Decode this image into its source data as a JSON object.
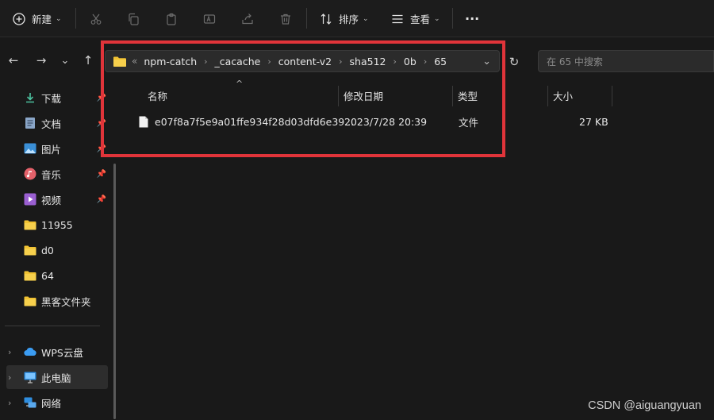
{
  "toolbar": {
    "new_label": "新建",
    "sort_label": "排序",
    "view_label": "查看",
    "more_label": "···",
    "icons": [
      "plus-circle-icon",
      "cut-icon",
      "copy-icon",
      "paste-icon",
      "rename-icon",
      "share-icon",
      "delete-icon",
      "sort-icon",
      "view-icon",
      "more-icon"
    ]
  },
  "nav": {
    "back_icon": "←",
    "forward_icon": "→",
    "recent_icon": "⌄",
    "up_icon": "↑",
    "overflow": "«",
    "breadcrumbs": [
      "npm-catch",
      "_cacache",
      "content-v2",
      "sha512",
      "0b",
      "65"
    ],
    "dropdown_icon": "⌄",
    "refresh_icon": "↻",
    "search_placeholder": "在 65 中搜索"
  },
  "sidebar": {
    "quick_access": [
      {
        "label": "下载",
        "icon": "download-icon",
        "pinned": true
      },
      {
        "label": "文档",
        "icon": "document-icon",
        "pinned": true
      },
      {
        "label": "图片",
        "icon": "picture-icon",
        "pinned": true
      },
      {
        "label": "音乐",
        "icon": "music-icon",
        "pinned": true
      },
      {
        "label": "视频",
        "icon": "video-icon",
        "pinned": true
      },
      {
        "label": "11955",
        "icon": "folder-icon",
        "pinned": false
      },
      {
        "label": "d0",
        "icon": "folder-icon",
        "pinned": false
      },
      {
        "label": "64",
        "icon": "folder-icon",
        "pinned": false
      },
      {
        "label": "黑客文件夹",
        "icon": "folder-icon",
        "pinned": false
      }
    ],
    "locations": [
      {
        "label": "WPS云盘",
        "icon": "cloud-icon"
      },
      {
        "label": "此电脑",
        "icon": "computer-icon",
        "selected": true
      },
      {
        "label": "网络",
        "icon": "network-icon"
      }
    ]
  },
  "columns": {
    "name": "名称",
    "date": "修改日期",
    "type": "类型",
    "size": "大小"
  },
  "files": [
    {
      "name": "e07f8a7f5e9a01ffe934f28d03dfd6e39...",
      "date": "2023/7/28 20:39",
      "type": "文件",
      "size": "27 KB"
    }
  ],
  "watermark": "CSDN @aiguangyuan",
  "colors": {
    "background": "#191919",
    "highlight_border": "#e0343a",
    "folder": "#f1c232"
  }
}
